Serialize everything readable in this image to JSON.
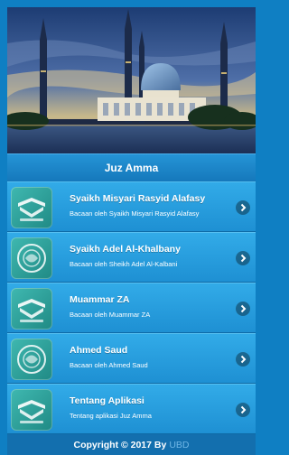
{
  "header": {
    "title": "Juz Amma"
  },
  "menu": {
    "items": [
      {
        "title": "Syaikh Misyari Rasyid Alafasy",
        "subtitle": "Bacaan oleh Syaikh Misyari Rasyid Alafasy",
        "icon": "quran-book-icon"
      },
      {
        "title": "Syaikh Adel Al-Khalbany",
        "subtitle": "Bacaan oleh Sheikh Adel Al-Kalbani",
        "icon": "quran-emblem-icon"
      },
      {
        "title": "Muammar ZA",
        "subtitle": "Bacaan oleh Muammar ZA",
        "icon": "quran-book-icon"
      },
      {
        "title": "Ahmed Saud",
        "subtitle": "Bacaan oleh Ahmed Saud",
        "icon": "quran-emblem-icon"
      },
      {
        "title": "Tentang Aplikasi",
        "subtitle": "Tentang aplikasi Juz Amma",
        "icon": "quran-book-icon"
      }
    ]
  },
  "footer": {
    "text": "Copyright © 2017 By",
    "link": "UBD"
  },
  "colors": {
    "primary": "#0f7fc3",
    "item": "#2a9fe0",
    "thumb": "#2c9f99"
  }
}
